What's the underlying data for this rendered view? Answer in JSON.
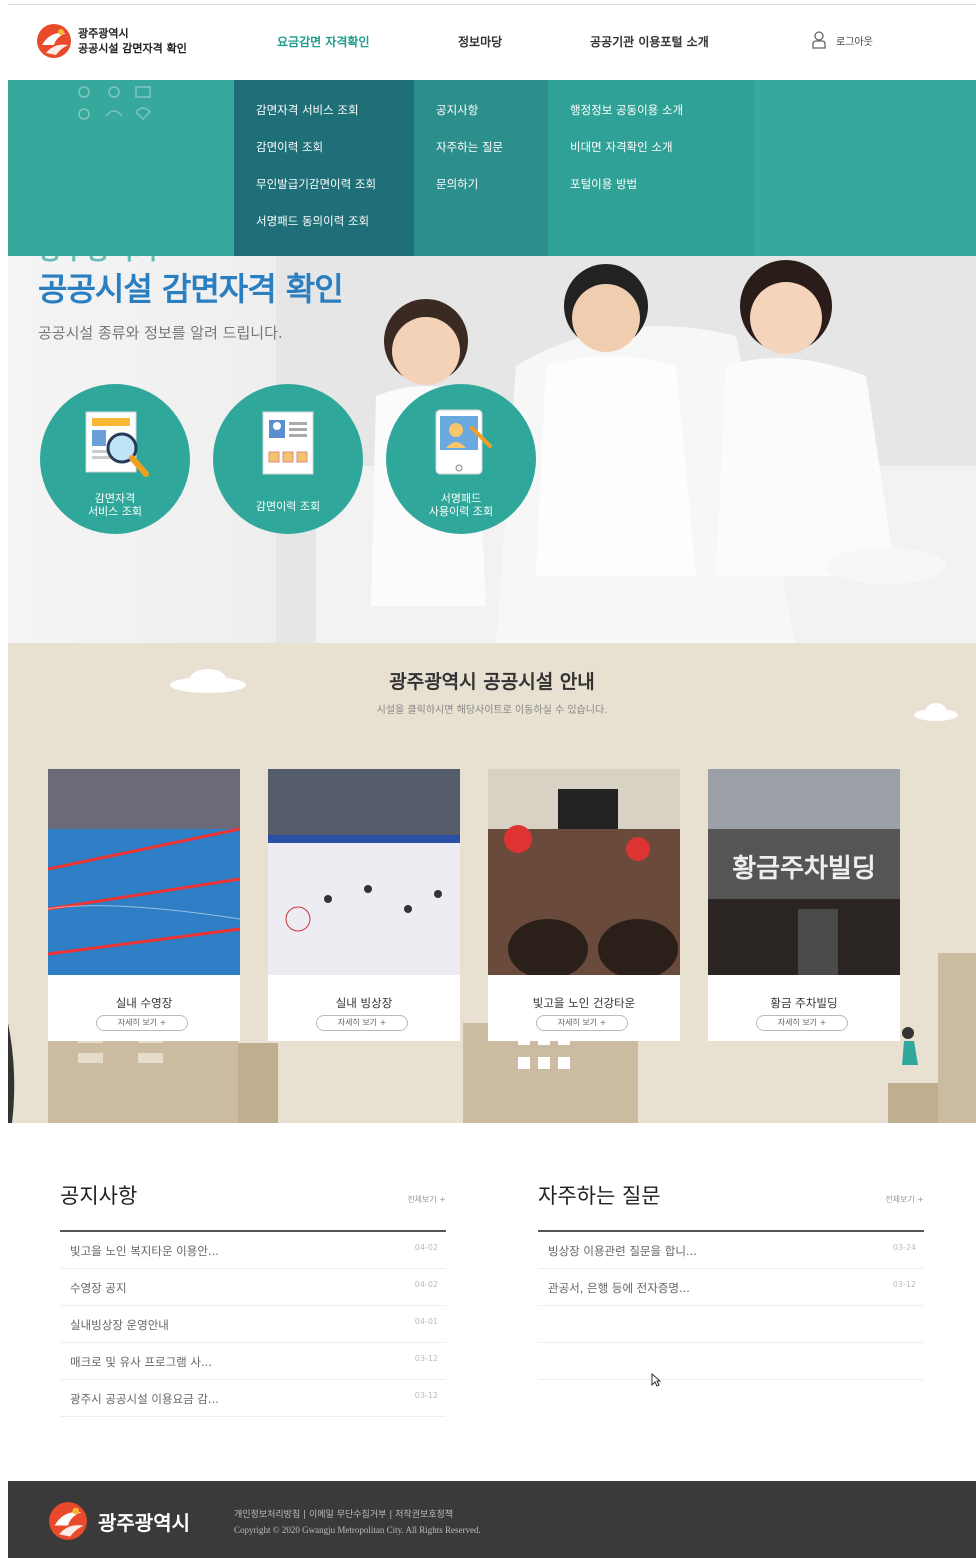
{
  "header": {
    "logo_line1": "광주광역시",
    "logo_line2": "공공시설 감면자격 확인",
    "nav": [
      "요금감면 자격확인",
      "정보마당",
      "공공기관 이용포털 소개"
    ],
    "logout": "로그아웃"
  },
  "dropdown": {
    "col1": [
      "감면자격 서비스 조회",
      "감면이력 조회",
      "무인발급기감면이력 조회",
      "서명패드 동의이력 조회"
    ],
    "col2": [
      "공지사항",
      "자주하는 질문",
      "문의하기"
    ],
    "col3": [
      "행정정보 공동이용 소개",
      "비대면 자격확인 소개",
      "포털이용 방법"
    ]
  },
  "hero": {
    "overlay_title": "광주광역시",
    "title": "공공시설 감면자격 확인",
    "desc": "공공시설 종류와 정보를 알려 드립니다.",
    "buttons": [
      {
        "label": "감면자격\n서비스 조회",
        "icon": "search-document-icon"
      },
      {
        "label": "감면이력 조회",
        "icon": "id-card-icon"
      },
      {
        "label": "서명패드\n사용이력 조회",
        "icon": "signature-pad-icon"
      }
    ]
  },
  "facilities": {
    "title": "광주광역시 공공시설 안내",
    "desc": "시설을 클릭하시면 해당사이트로 이동하실 수 있습니다.",
    "more_label": "자세히 보기 +",
    "cards": [
      {
        "name": "실내 수영장"
      },
      {
        "name": "실내 빙상장"
      },
      {
        "name": "빛고을 노인 건강타운"
      },
      {
        "name": "황금 주차빌딩"
      }
    ],
    "parking_sign": "황금주차빌딩"
  },
  "notice": {
    "title": "공지사항",
    "more": "전체보기 +",
    "items": [
      {
        "text": "빛고을 노인 복지타운 이용안...",
        "date": "04-02"
      },
      {
        "text": "수영장 공지",
        "date": "04-02"
      },
      {
        "text": "실내빙상장 운영안내",
        "date": "04-01"
      },
      {
        "text": "매크로 및 유사 프로그램 사...",
        "date": "03-12"
      },
      {
        "text": "광주시 공공시설 이용요금 감...",
        "date": "03-12"
      }
    ]
  },
  "faq": {
    "title": "자주하는 질문",
    "more": "전체보기 +",
    "items": [
      {
        "text": "빙상장 이용관련 질문을 합니...",
        "date": "03-24"
      },
      {
        "text": "관공서, 은행 등에 전자증명...",
        "date": "03-12"
      }
    ]
  },
  "footer": {
    "logo": "광주광역시",
    "links": "개인정보처리방침 | 이메일 무단수집거부 | 저작권보호정책",
    "copyright": "Copyright © 2020 Gwangju Metropolitan City. All Rights Reserved."
  },
  "colors": {
    "accent": "#2fa79b",
    "title_blue": "#2a7fc0",
    "dropdown_dark": "#1f6f78",
    "footer": "#3a3a3a"
  }
}
